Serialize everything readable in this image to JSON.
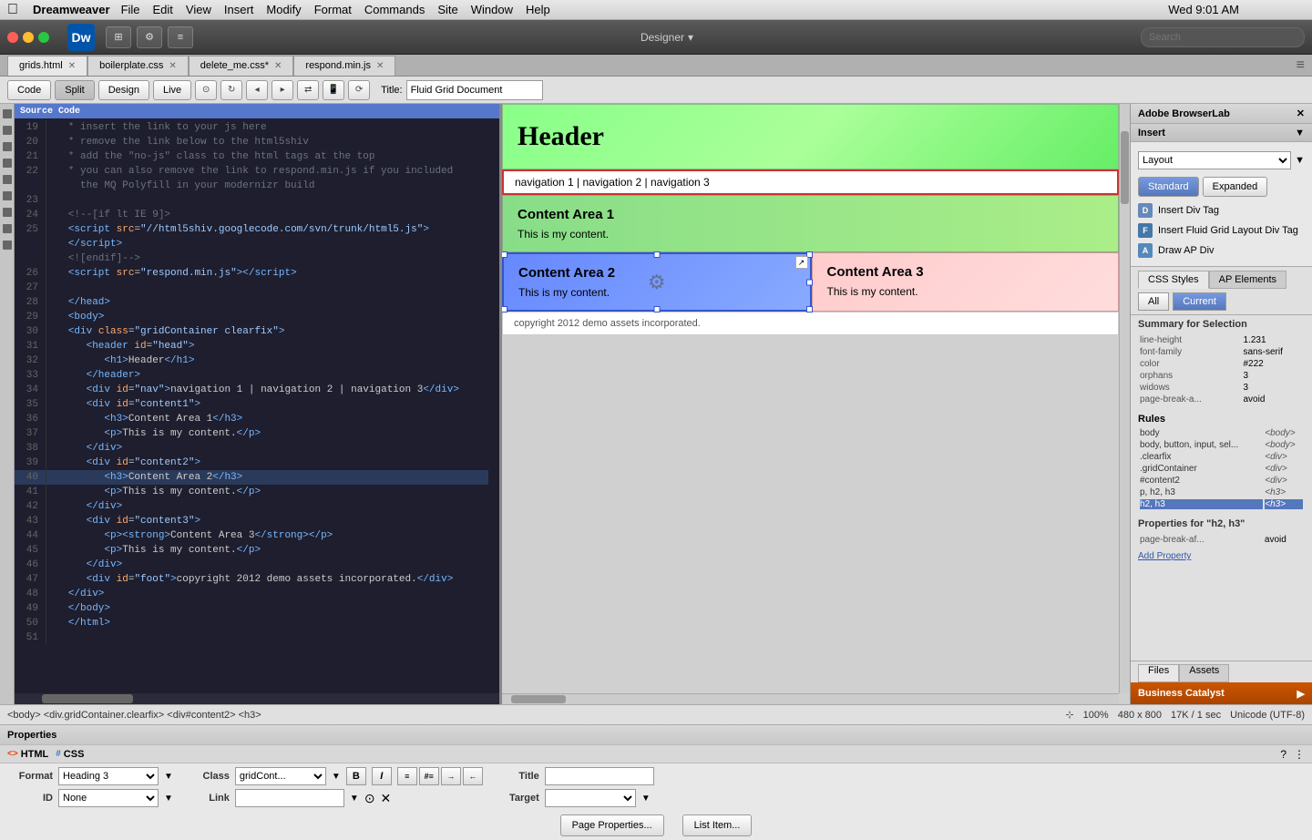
{
  "menubar": {
    "apple": "⌘",
    "app_name": "Dreamweaver",
    "menus": [
      "File",
      "Edit",
      "View",
      "Insert",
      "Modify",
      "Format",
      "Commands",
      "Site",
      "Window",
      "Help"
    ],
    "time": "Wed 9:01 AM"
  },
  "toolbar": {
    "dw_label": "Dw",
    "designer_label": "Designer",
    "designer_arrow": "▾"
  },
  "tabs": {
    "file_tab": "grids.html",
    "other_tabs": [
      "boilerplate.css",
      "delete_me.css*",
      "respond.min.js"
    ]
  },
  "editor_toolbar": {
    "code_btn": "Code",
    "split_btn": "Split",
    "design_btn": "Design",
    "live_btn": "Live",
    "title_label": "Title:",
    "title_value": "Fluid Grid Document"
  },
  "source_code_badge": "Source Code",
  "code_lines": [
    {
      "num": "19",
      "content": "   * insert the link to your js here"
    },
    {
      "num": "20",
      "content": "   * remove the link below to the html5shiv"
    },
    {
      "num": "21",
      "content": "   * add the \"no-js\" class to the html tags at the top"
    },
    {
      "num": "22",
      "content": "   * you can also remove the link to respond.min.js if you included"
    },
    {
      "num": "",
      "content": "     the MQ Polyfill in your modernizr build"
    },
    {
      "num": "23",
      "content": ""
    },
    {
      "num": "24",
      "content": "   <!--[if lt IE 9]>"
    },
    {
      "num": "25",
      "content": "   <script src=\"//html5shiv.googlecode.com/svn/trunk/html5.js\">"
    },
    {
      "num": "",
      "content": "   <\\/script>"
    },
    {
      "num": "",
      "content": "   <![endif]-->"
    },
    {
      "num": "26",
      "content": "   <script src=\"respond.min.js\"><\\/script>"
    },
    {
      "num": "27",
      "content": ""
    },
    {
      "num": "28",
      "content": "   <\\/head>"
    },
    {
      "num": "29",
      "content": "   <body>"
    },
    {
      "num": "30",
      "content": "   <div class=\"gridContainer clearfix\">"
    },
    {
      "num": "31",
      "content": "      <header id=\"head\">"
    },
    {
      "num": "32",
      "content": "         <h1>Header<\\/h1>"
    },
    {
      "num": "33",
      "content": "      <\\/header>"
    },
    {
      "num": "34",
      "content": "      <div id=\"nav\">navigation 1 | navigation 2 | navigation 3<\\/div>"
    },
    {
      "num": "35",
      "content": "      <div id=\"content1\">"
    },
    {
      "num": "36",
      "content": "         <h3>Content Area 1<\\/h3>"
    },
    {
      "num": "37",
      "content": "         <p>This is my content.<\\/p>"
    },
    {
      "num": "38",
      "content": "      <\\/div>"
    },
    {
      "num": "39",
      "content": "      <div id=\"content2\">"
    },
    {
      "num": "40",
      "content": "         <h3>Content Area 2<\\/h3>"
    },
    {
      "num": "41",
      "content": "         <p>This is my content.<\\/p>"
    },
    {
      "num": "42",
      "content": "      <\\/div>"
    },
    {
      "num": "43",
      "content": "      <div id=\"content3\">"
    },
    {
      "num": "44",
      "content": "         <p><strong>Content Area 3<\\/strong><\\/p>"
    },
    {
      "num": "45",
      "content": "         <p>This is my content.<\\/p>"
    },
    {
      "num": "46",
      "content": "      <\\/div>"
    },
    {
      "num": "47",
      "content": "      <div id=\"foot\">copyright 2012 demo assets incorporated.<\\/div>"
    },
    {
      "num": "48",
      "content": "   <\\/div>"
    },
    {
      "num": "49",
      "content": "   <\\/body>"
    },
    {
      "num": "50",
      "content": "   <\\/html>"
    },
    {
      "num": "51",
      "content": ""
    }
  ],
  "design": {
    "header_text": "Header",
    "nav_text": "navigation 1 | navigation 2 | navigation 3",
    "content1_title": "Content Area 1",
    "content1_body": "This is my content.",
    "content2_title": "Content Area 2",
    "content2_body": "This is my content.",
    "content3_title": "Content Area 3",
    "content3_body": "This is my content.",
    "footer_text": "copyright 2012 demo assets incorporated."
  },
  "status_bar": {
    "breadcrumb": "<body> <div.gridContainer.clearfix> <div#content2> <h3>",
    "zoom": "100%",
    "dimensions": "480 x 800",
    "file_info": "17K / 1 sec",
    "encoding": "Unicode (UTF-8)"
  },
  "properties_panel": {
    "title": "Properties",
    "html_label": "HTML",
    "css_label": "CSS",
    "format_label": "Format",
    "format_value": "Heading 3",
    "class_label": "Class",
    "class_value": "gridCont...",
    "bold_btn": "B",
    "italic_btn": "I",
    "id_label": "ID",
    "id_value": "None",
    "link_label": "Link",
    "title_label": "Title",
    "target_label": "Target",
    "page_props_btn": "Page Properties...",
    "list_item_btn": "List Item..."
  },
  "right_panel": {
    "browserlab_header": "Adobe BrowserLab",
    "insert_header": "Insert",
    "layout_label": "Layout",
    "standard_label": "Standard",
    "expanded_label": "Expanded",
    "insert_items": [
      {
        "label": "Insert Div Tag",
        "icon": "div"
      },
      {
        "label": "Insert Fluid Grid Layout Div Tag",
        "icon": "fluid"
      },
      {
        "label": "Draw AP Div",
        "icon": "ap"
      }
    ],
    "css_styles_tab": "CSS Styles",
    "ap_elements_tab": "AP Elements",
    "all_btn": "All",
    "current_btn": "Current",
    "summary_title": "Summary for Selection",
    "summary_items": [
      {
        "prop": "line-height",
        "val": "1.231"
      },
      {
        "prop": "font-family",
        "val": "sans-serif"
      },
      {
        "prop": "color",
        "val": "#222"
      },
      {
        "prop": "orphans",
        "val": "3"
      },
      {
        "prop": "widows",
        "val": "3"
      },
      {
        "prop": "page-break-a...",
        "val": "avoid"
      }
    ],
    "rules_title": "Rules",
    "rules_items": [
      {
        "selector": "body",
        "element": "<body>"
      },
      {
        "selector": "body, button, input, sel...",
        "element": "<body>"
      },
      {
        "selector": ".clearfix",
        "element": "<div>"
      },
      {
        "selector": ".gridContainer",
        "element": "<div>"
      },
      {
        "selector": "#content2",
        "element": "<div>"
      },
      {
        "selector": "p, h2, h3",
        "element": "<h3>"
      },
      {
        "selector": "h2, h3",
        "element": "<h3>"
      }
    ],
    "props_for_title": "Properties for \"h2, h3\"",
    "props_for_items": [
      {
        "prop": "page-break-af...",
        "val": "avoid"
      }
    ],
    "add_property": "Add Property",
    "files_tab": "Files",
    "assets_tab": "Assets",
    "bc_label": "Business Catalyst"
  }
}
